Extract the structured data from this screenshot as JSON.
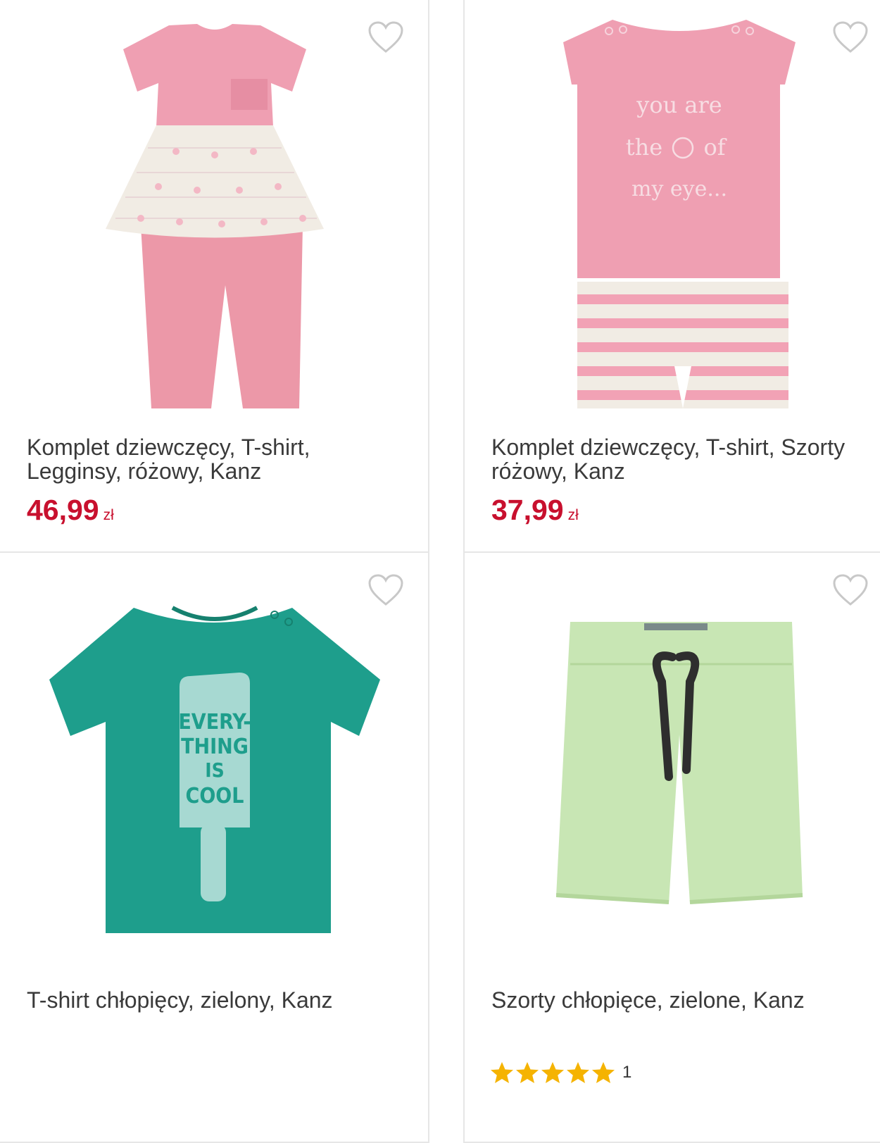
{
  "colors": {
    "price": "#c8102e",
    "border": "#e6e6e6",
    "star": "#f5b301",
    "heart": "#c8c8c8"
  },
  "products": [
    {
      "image": "pink-tunic-leggings-set",
      "title": "Komplet dziewczęcy, T-shirt,\nLegginsy, różowy, Kanz",
      "price": "46,99",
      "currency": "zł"
    },
    {
      "image": "pink-tshirt-striped-shorts-set",
      "image_text": [
        "you are",
        "the",
        "of",
        "my eye..."
      ],
      "title": "Komplet dziewczęcy, T-shirt, Szorty\nróżowy, Kanz",
      "price": "37,99",
      "currency": "zł"
    },
    {
      "image": "green-tshirt-popsicle",
      "image_text": [
        "EVERY-",
        "THING",
        "IS",
        "COOL"
      ],
      "title": "T-shirt chłopięcy, zielony, Kanz"
    },
    {
      "image": "light-green-shorts",
      "title": "Szorty chłopięce, zielone, Kanz",
      "rating": 5,
      "review_count": "1"
    }
  ]
}
